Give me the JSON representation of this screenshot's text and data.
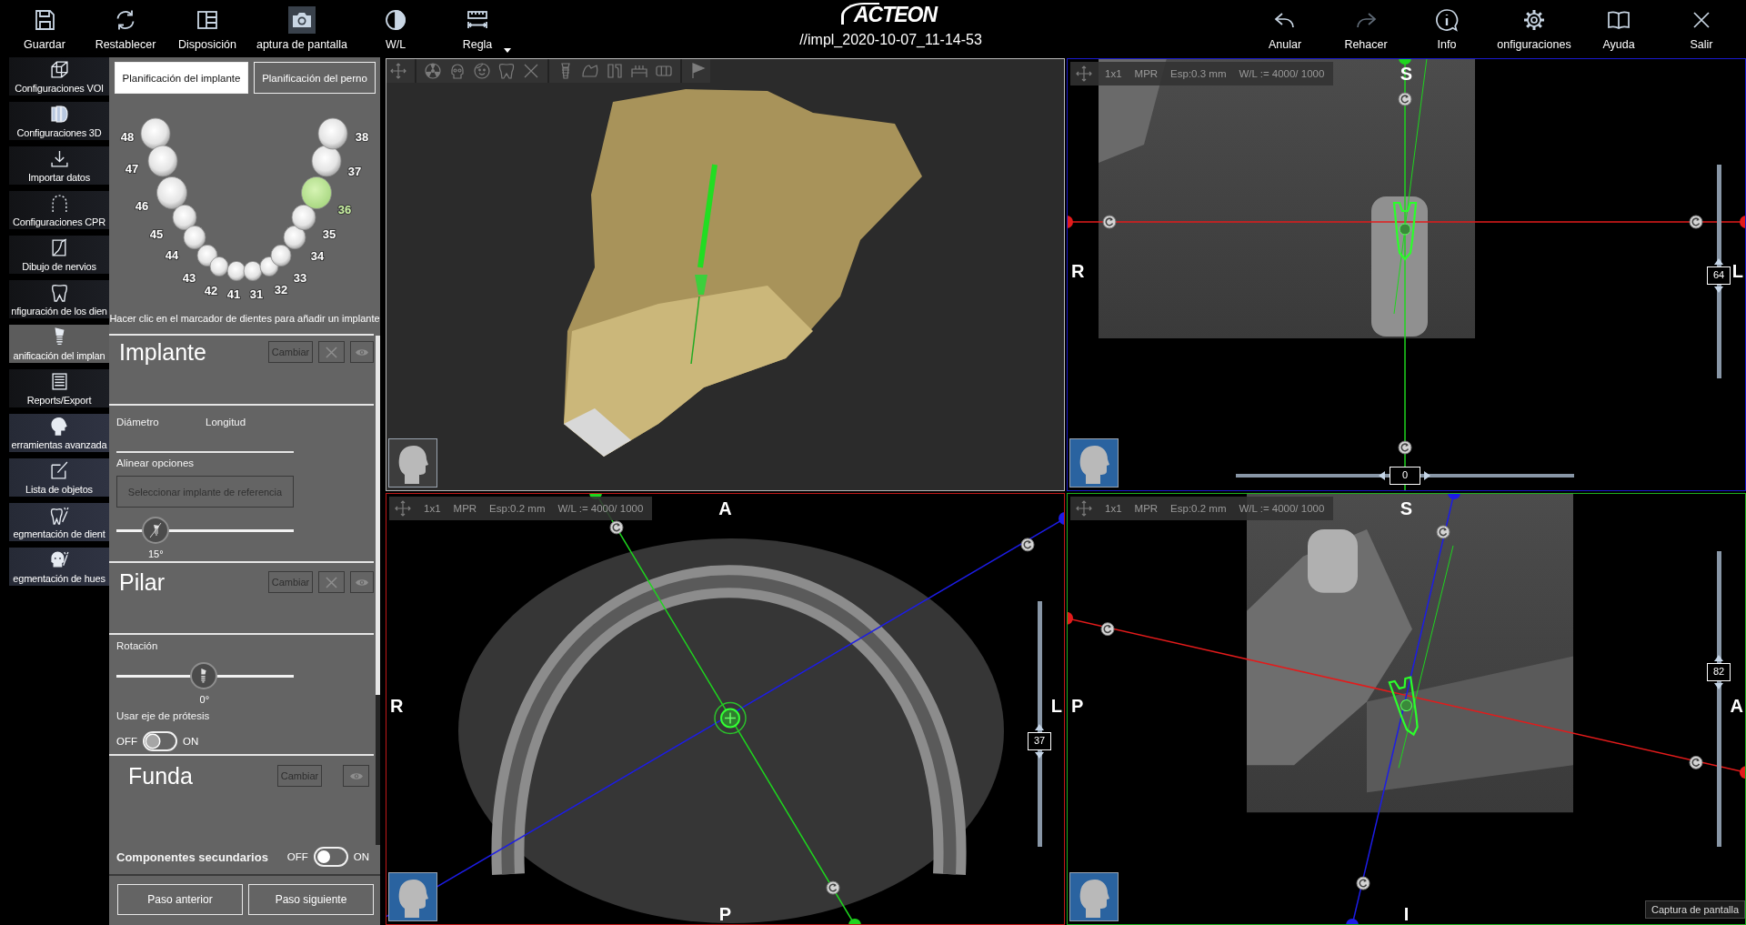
{
  "toolbar": {
    "tools": [
      {
        "label": "Guardar",
        "selected": false,
        "dropdown": false
      },
      {
        "label": "Restablecer",
        "selected": false,
        "dropdown": false
      },
      {
        "label": "Disposición",
        "selected": false,
        "dropdown": false
      },
      {
        "label": "aptura de pantalla",
        "selected": true,
        "dropdown": false
      },
      {
        "label": "W/L",
        "selected": false,
        "dropdown": false
      },
      {
        "label": "Regla",
        "selected": false,
        "dropdown": true
      }
    ],
    "logo": "ACTEON",
    "title": "//impl_2020-10-07_11-14-53",
    "actions": [
      {
        "label": "Anular",
        "disabled": false
      },
      {
        "label": "Rehacer",
        "disabled": true
      },
      {
        "label": "Info",
        "disabled": false
      },
      {
        "label": "onfiguraciones",
        "disabled": false
      },
      {
        "label": "Ayuda",
        "disabled": false
      },
      {
        "label": "Salir",
        "disabled": false
      }
    ]
  },
  "sidebar": {
    "items": [
      {
        "label": "Configuraciones VOI",
        "kind": "step",
        "selected": false
      },
      {
        "label": "Configuraciones 3D",
        "kind": "step",
        "selected": false
      },
      {
        "label": "Importar datos",
        "kind": "step",
        "selected": false
      },
      {
        "label": "Configuraciones CPR",
        "kind": "step",
        "selected": false
      },
      {
        "label": "Dibujo de nervios",
        "kind": "step",
        "selected": false
      },
      {
        "label": "nfiguración de los dien",
        "kind": "step",
        "selected": false
      },
      {
        "label": "anificación del implan",
        "kind": "step",
        "selected": true
      },
      {
        "label": "Reports/Export",
        "kind": "step",
        "selected": false
      },
      {
        "label": "erramientas avanzada",
        "kind": "tool",
        "selected": false
      },
      {
        "label": "Lista de objetos",
        "kind": "tool",
        "selected": false
      },
      {
        "label": "egmentación de dient",
        "kind": "tool",
        "selected": false
      },
      {
        "label": "egmentación de hues",
        "kind": "tool",
        "selected": false
      }
    ]
  },
  "panel": {
    "tabs": [
      {
        "label": "Planificación del implante",
        "selected": true
      },
      {
        "label": "Planificación del perno",
        "selected": false
      }
    ],
    "teeth": [
      {
        "number": "48",
        "selected": false
      },
      {
        "number": "47",
        "selected": false
      },
      {
        "number": "46",
        "selected": false
      },
      {
        "number": "45",
        "selected": false
      },
      {
        "number": "44",
        "selected": false
      },
      {
        "number": "43",
        "selected": false
      },
      {
        "number": "42",
        "selected": false
      },
      {
        "number": "41",
        "selected": false
      },
      {
        "number": "31",
        "selected": false
      },
      {
        "number": "32",
        "selected": false
      },
      {
        "number": "33",
        "selected": false
      },
      {
        "number": "34",
        "selected": false
      },
      {
        "number": "35",
        "selected": false
      },
      {
        "number": "36",
        "selected": true
      },
      {
        "number": "37",
        "selected": false
      },
      {
        "number": "38",
        "selected": false
      }
    ],
    "hint": "Hacer clic en el marcador de dientes para añadir un implante",
    "implant": {
      "title": "Implante",
      "buttons": [
        {
          "kind": "change",
          "label": "Cambiar",
          "disabled": true
        },
        {
          "kind": "remove",
          "disabled": true
        },
        {
          "kind": "visibility",
          "disabled": true
        }
      ],
      "fields": [
        "Diámetro",
        "Longitud"
      ],
      "align_label": "Alinear opciones",
      "reference_button": {
        "label": "Seleccionar implante de referencia",
        "disabled": true
      },
      "angle": {
        "level": 0.22,
        "reading": "15°"
      }
    },
    "abutment": {
      "title": "Pilar",
      "buttons": [
        {
          "kind": "change",
          "label": "Cambiar",
          "disabled": true
        },
        {
          "kind": "remove",
          "disabled": true
        },
        {
          "kind": "visibility",
          "disabled": true
        }
      ],
      "rotation": {
        "label": "Rotación",
        "level": 0.49,
        "reading": "0°"
      },
      "axis_toggle": {
        "label": "Usar eje de prótesis",
        "off_label": "OFF",
        "on_label": "ON",
        "on": false,
        "disabled": true
      }
    },
    "crown": {
      "title": "Funda",
      "buttons": [
        {
          "kind": "change",
          "label": "Cambiar",
          "disabled": true
        },
        {
          "kind": "visibility",
          "disabled": true
        }
      ]
    },
    "secondary_toggle": {
      "label": "Componentes secundarios",
      "off_label": "OFF",
      "on_label": "ON",
      "on": false,
      "disabled": false
    },
    "steps": [
      {
        "label": "Paso anterior"
      },
      {
        "label": "Paso siguiente"
      }
    ]
  },
  "views": [
    {
      "kind": "render",
      "color": "#b8b8b8"
    },
    {
      "kind": "slice",
      "color": "#1a1ad0",
      "info": [
        "1x1",
        "MPR",
        "Esp:0.3 mm",
        "W/L := 4000/ 1000"
      ],
      "labels": {
        "top": "S",
        "left": "R",
        "right": "L"
      },
      "slider": {
        "level": 0.48,
        "reading": "64"
      },
      "offset": {
        "level": 0.5,
        "reading": "0"
      }
    },
    {
      "kind": "slice",
      "color": "#c01818",
      "info": [
        "1x1",
        "MPR",
        "Esp:0.2 mm",
        "W/L := 4000/ 1000"
      ],
      "labels": {
        "top": "A",
        "left": "R",
        "right": "L",
        "bottom": "P"
      },
      "slider": {
        "level": 0.43,
        "reading": "37"
      }
    },
    {
      "kind": "slice",
      "color": "#1eb01e",
      "info": [
        "1x1",
        "MPR",
        "Esp:0.2 mm",
        "W/L := 4000/ 1000"
      ],
      "labels": {
        "top": "S",
        "left": "P",
        "right": "A",
        "bottom": "I"
      },
      "slider": {
        "level": 0.59,
        "reading": "82"
      }
    }
  ],
  "tooltip": "Captura de pantalla"
}
